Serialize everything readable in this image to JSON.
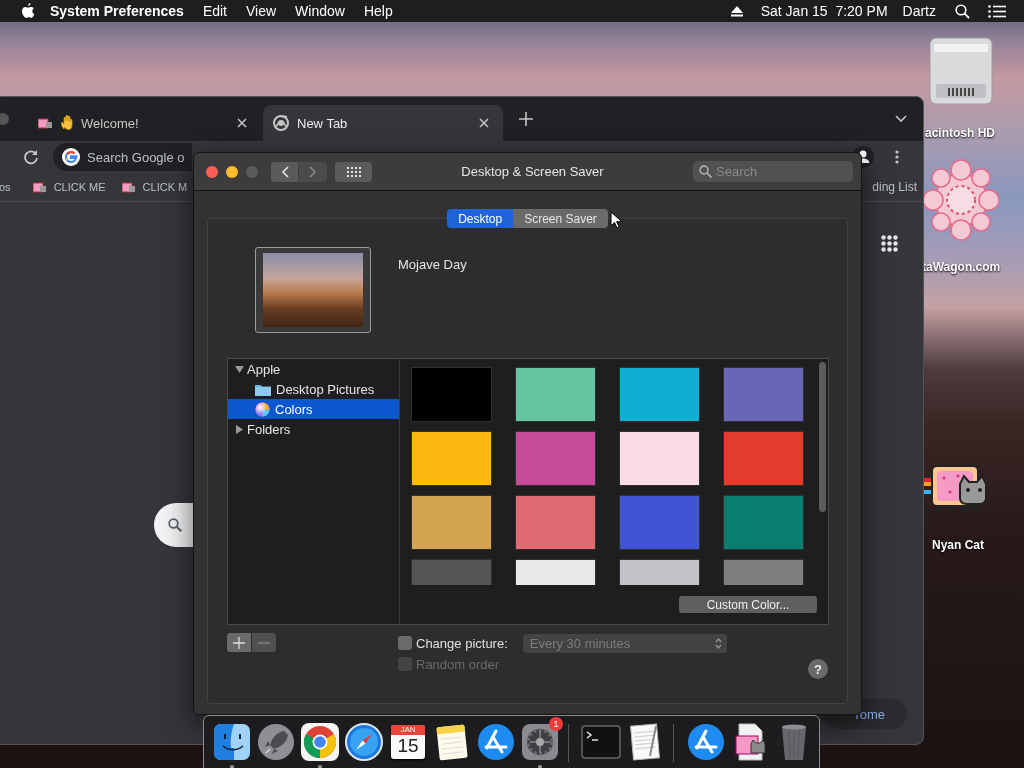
{
  "menu_bar": {
    "app": "System Preferences",
    "items": [
      "Edit",
      "View",
      "Window",
      "Help"
    ],
    "clock": "Sat Jan 15  7:20 PM",
    "user": "Dartz"
  },
  "desktop_icons": [
    {
      "label": "acintosh HD",
      "kind": "disk"
    },
    {
      "label": "taWagon.com",
      "kind": "flower"
    },
    {
      "label": "Nyan Cat",
      "kind": "cat"
    }
  ],
  "browser": {
    "tabs": [
      {
        "title": "Welcome!",
        "kind": "welcome",
        "selected": false
      },
      {
        "title": "New Tab",
        "kind": "newtab",
        "selected": true
      }
    ],
    "omnibox": "Search Google o",
    "bookmarks": [
      "os",
      "CLICK ME",
      "CLICK M"
    ],
    "reading_list": "ding List",
    "customize": "rome"
  },
  "prefs": {
    "title": "Desktop & Screen Saver",
    "search": {
      "placeholder": "Search"
    },
    "tabs": [
      {
        "label": "Desktop",
        "selected": true
      },
      {
        "label": "Screen Saver",
        "selected": false
      }
    ],
    "picture_name": "Mojave Day",
    "sources": [
      {
        "label": "Apple",
        "expanded": true,
        "selected": false,
        "children": [
          {
            "label": "Desktop Pictures",
            "kind": "folder",
            "selected": false
          },
          {
            "label": "Colors",
            "kind": "colors",
            "selected": true
          }
        ]
      },
      {
        "label": "Folders",
        "expanded": false,
        "selected": false
      }
    ],
    "swatches": [
      {
        "color": "#000000"
      },
      {
        "color": "#66c4a0"
      },
      {
        "color": "#11aed3"
      },
      {
        "color": "#6a66b6"
      },
      {
        "color": "#fdb813"
      },
      {
        "color": "#c64a97"
      },
      {
        "color": "#fbdbe3"
      },
      {
        "color": "#e53b2c"
      },
      {
        "color": "#d3a452"
      },
      {
        "color": "#e06b73"
      },
      {
        "color": "#4055d3"
      },
      {
        "color": "#0a7f6f"
      },
      {
        "color": "#555555"
      },
      {
        "color": "#e8e8e8"
      },
      {
        "color": "#c2c3c8"
      },
      {
        "color": "#7e7e80"
      }
    ],
    "custom_color": "Custom Color...",
    "list_buttons": [
      {
        "kind": "add",
        "disabled": false
      },
      {
        "kind": "remove",
        "disabled": true
      }
    ],
    "change_picture": {
      "label": "Change picture:",
      "checked": false,
      "disabled": false
    },
    "interval": {
      "value": "Every 30 minutes",
      "disabled": true
    },
    "random_order": {
      "label": "Random order",
      "checked": false,
      "disabled": true
    },
    "help": "?"
  },
  "dock": [
    {
      "kind": "finder",
      "running": true
    },
    {
      "kind": "launchpad",
      "running": false
    },
    {
      "kind": "chrome",
      "running": true
    },
    {
      "kind": "safari",
      "running": false
    },
    {
      "kind": "calendar",
      "running": false,
      "month": "JAN",
      "day": "15"
    },
    {
      "kind": "notes",
      "running": false
    },
    {
      "kind": "appstore",
      "running": false
    },
    {
      "kind": "sysprefs",
      "running": true,
      "badge": "1"
    },
    {
      "kind": "separator"
    },
    {
      "kind": "terminal",
      "running": false
    },
    {
      "kind": "textedit",
      "running": false
    },
    {
      "kind": "separator"
    },
    {
      "kind": "appstore",
      "running": false
    },
    {
      "kind": "nyanfile",
      "running": false
    },
    {
      "kind": "trash",
      "running": false
    }
  ]
}
